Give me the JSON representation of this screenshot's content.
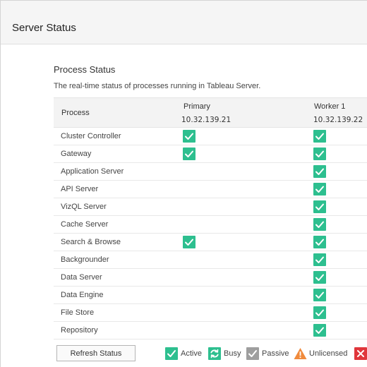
{
  "header": {
    "title": "Server Status"
  },
  "section": {
    "title": "Process Status",
    "description": "The real-time status of processes running in Tableau Server."
  },
  "table": {
    "process_header": "Process",
    "nodes": [
      {
        "name": "Primary",
        "ip": "10.32.139.21"
      },
      {
        "name": "Worker 1",
        "ip": "10.32.139.22"
      }
    ],
    "rows": [
      {
        "process": "Cluster Controller",
        "primary": "Active",
        "worker1": "Active"
      },
      {
        "process": "Gateway",
        "primary": "Active",
        "worker1": "Active"
      },
      {
        "process": "Application Server",
        "primary": "",
        "worker1": "Active"
      },
      {
        "process": "API Server",
        "primary": "",
        "worker1": "Active"
      },
      {
        "process": "VizQL Server",
        "primary": "",
        "worker1": "Active"
      },
      {
        "process": "Cache Server",
        "primary": "",
        "worker1": "Active"
      },
      {
        "process": "Search & Browse",
        "primary": "Active",
        "worker1": "Active"
      },
      {
        "process": "Backgrounder",
        "primary": "",
        "worker1": "Active"
      },
      {
        "process": "Data Server",
        "primary": "",
        "worker1": "Active"
      },
      {
        "process": "Data Engine",
        "primary": "",
        "worker1": "Active"
      },
      {
        "process": "File Store",
        "primary": "",
        "worker1": "Active"
      },
      {
        "process": "Repository",
        "primary": "",
        "worker1": "Active"
      }
    ]
  },
  "footer": {
    "refresh_label": "Refresh Status",
    "legend": [
      {
        "label": "Active",
        "icon": "active-check-icon",
        "color": "#2dbf8f"
      },
      {
        "label": "Busy",
        "icon": "busy-refresh-icon",
        "color": "#2dbf8f"
      },
      {
        "label": "Passive",
        "icon": "passive-check-icon",
        "color": "#9e9e9e"
      },
      {
        "label": "Unlicensed",
        "icon": "unlicensed-warning-icon",
        "color": "#f08a3c"
      },
      {
        "label": "",
        "icon": "down-x-icon",
        "color": "#e0363b"
      }
    ]
  }
}
